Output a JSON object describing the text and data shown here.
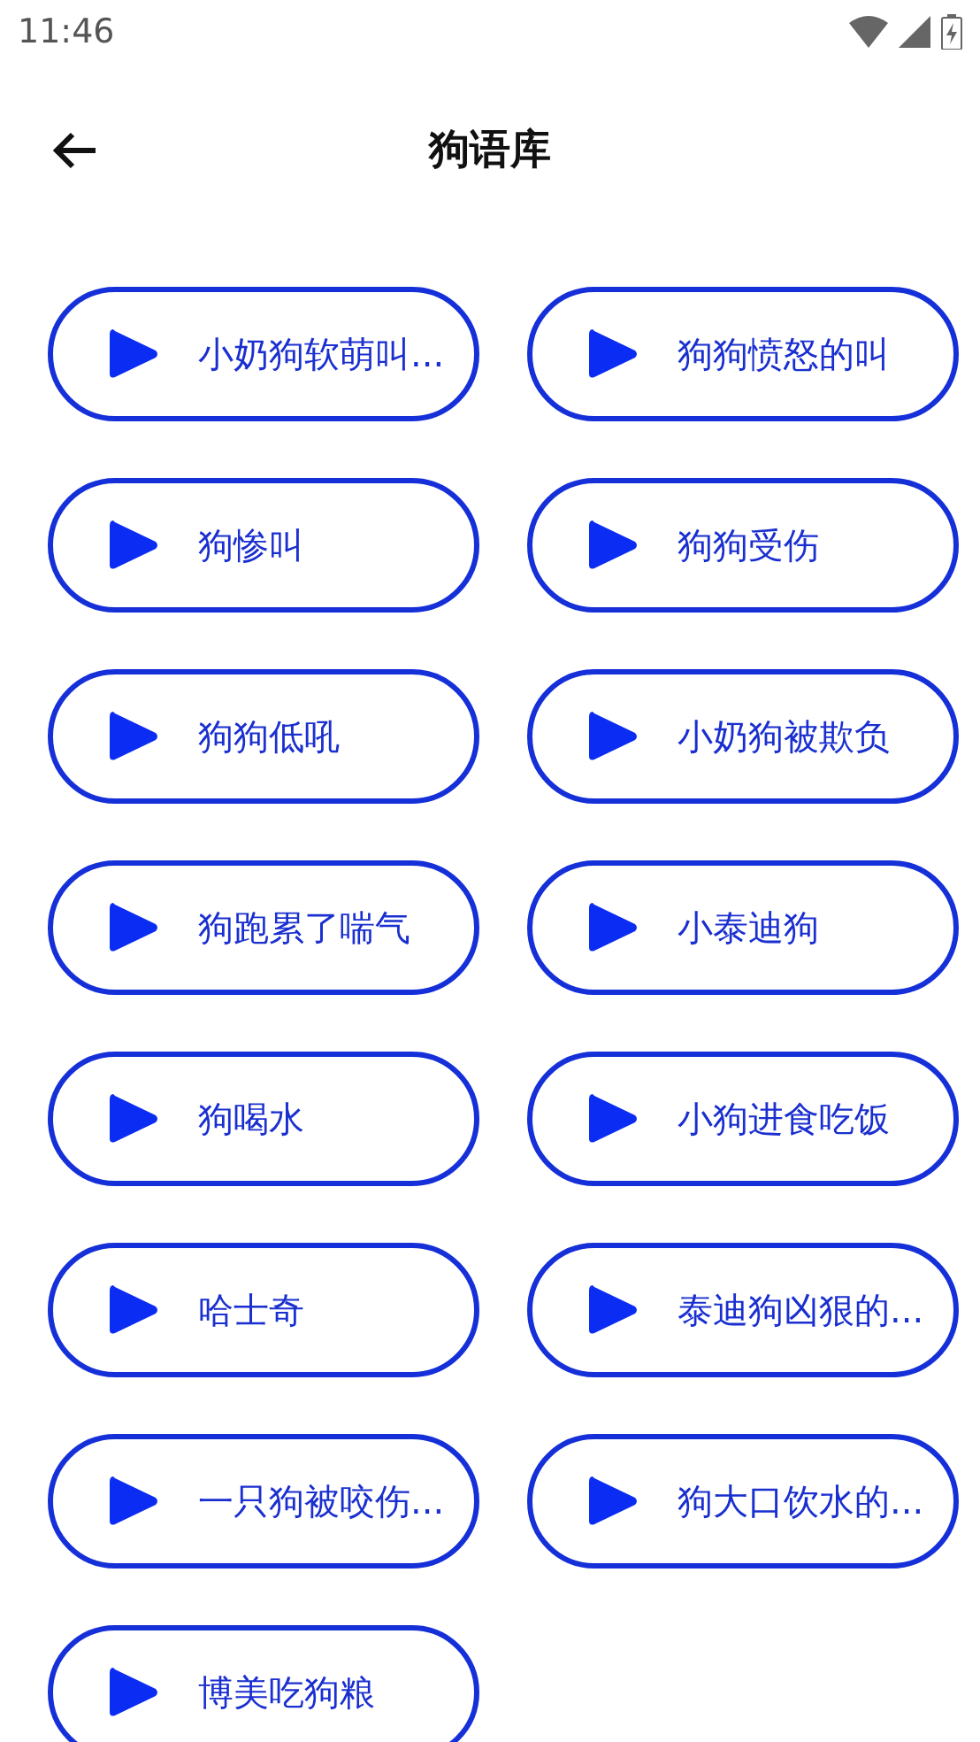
{
  "status_bar": {
    "time": "11:46"
  },
  "header": {
    "title": "狗语库"
  },
  "sounds": [
    {
      "label": "小奶狗软萌叫..."
    },
    {
      "label": "狗狗愤怒的叫"
    },
    {
      "label": "狗惨叫"
    },
    {
      "label": "狗狗受伤"
    },
    {
      "label": "狗狗低吼"
    },
    {
      "label": "小奶狗被欺负"
    },
    {
      "label": "狗跑累了喘气"
    },
    {
      "label": "小泰迪狗"
    },
    {
      "label": "狗喝水"
    },
    {
      "label": "小狗进食吃饭"
    },
    {
      "label": "哈士奇"
    },
    {
      "label": "泰迪狗凶狠的..."
    },
    {
      "label": "一只狗被咬伤..."
    },
    {
      "label": "狗大口饮水的..."
    },
    {
      "label": "博美吃狗粮"
    }
  ]
}
